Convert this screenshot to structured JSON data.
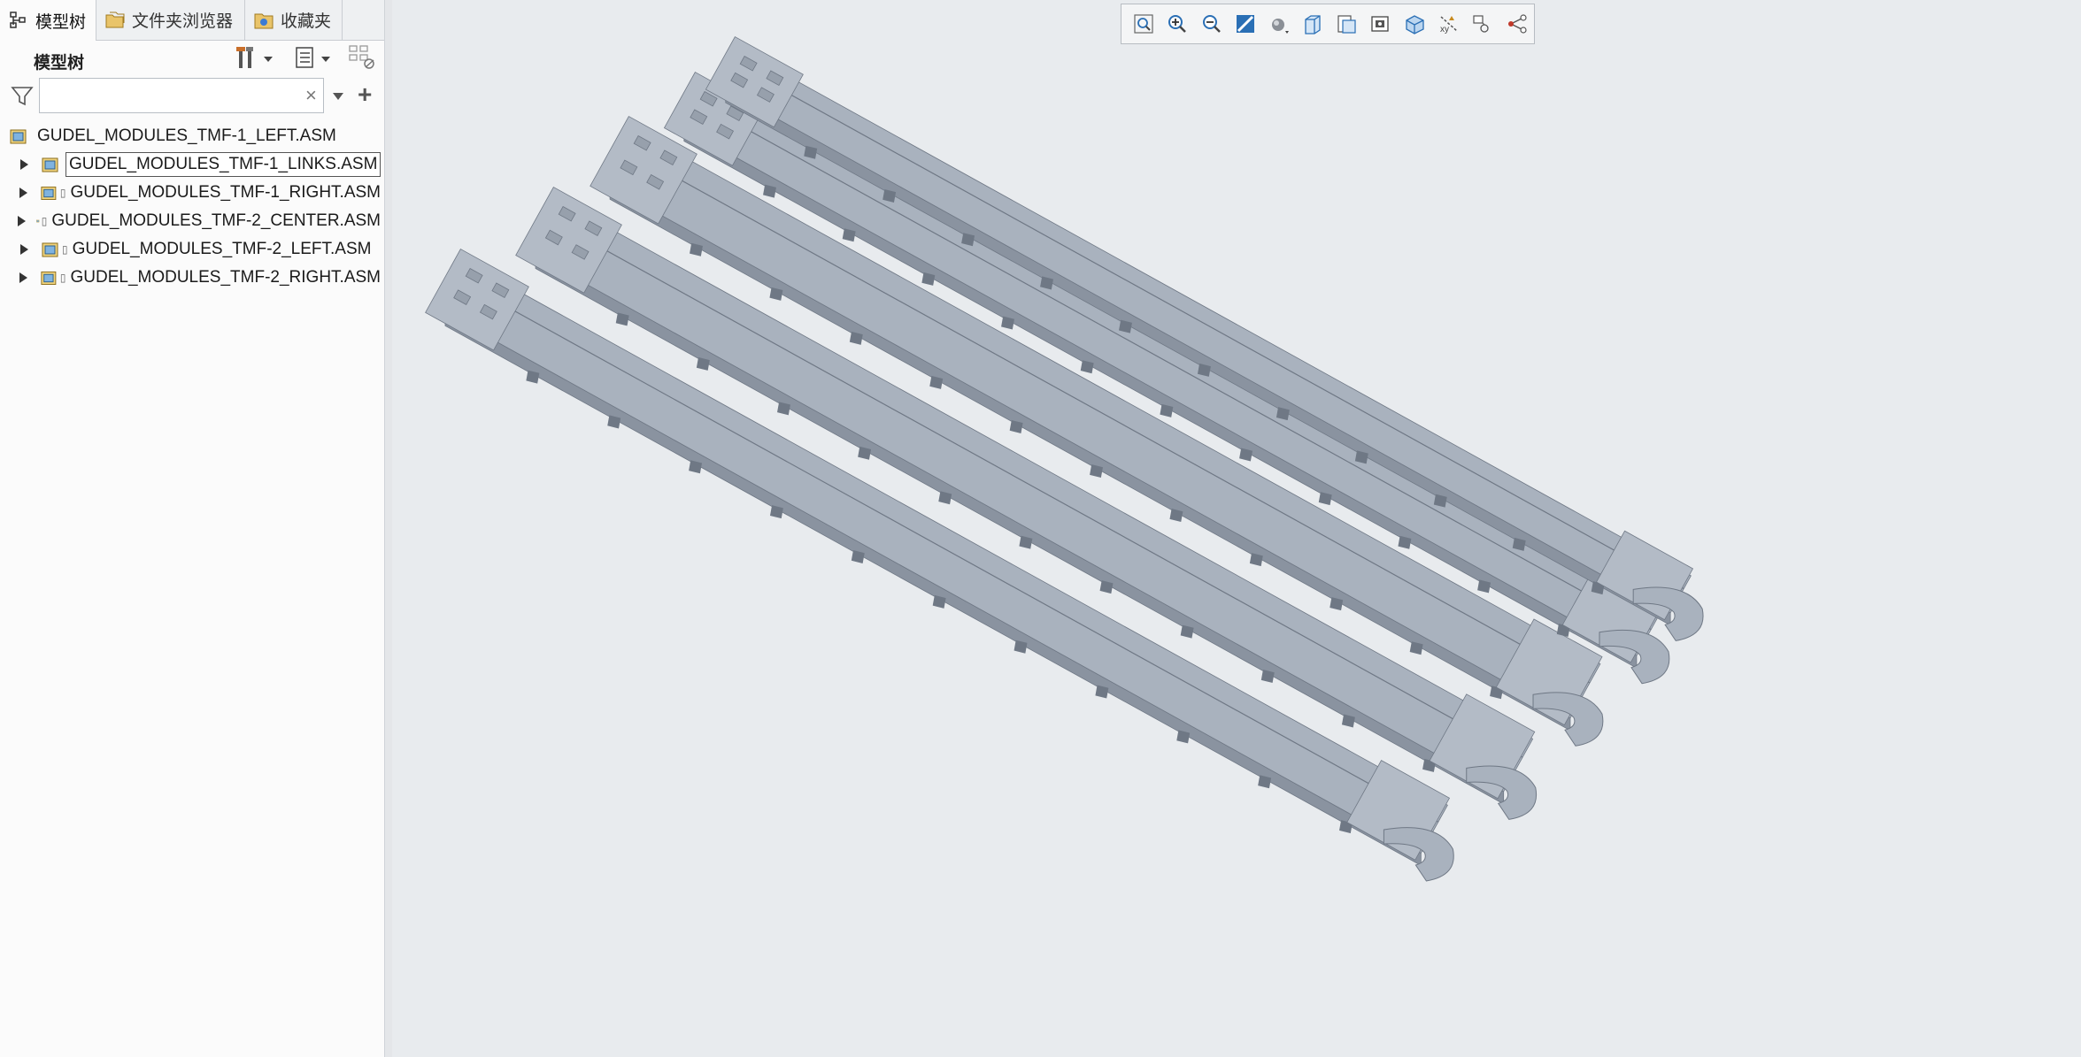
{
  "tabs": [
    {
      "label": "模型树",
      "icon": "model-tree-icon"
    },
    {
      "label": "文件夹浏览器",
      "icon": "folder-browser-icon"
    },
    {
      "label": "收藏夹",
      "icon": "favorites-icon"
    }
  ],
  "tree_header": {
    "title": "模型树",
    "settings_icon": "tools-icon",
    "show_icon": "list-view-icon",
    "columns_icon": "tree-columns-icon"
  },
  "filter": {
    "value": "",
    "placeholder": "",
    "clear_glyph": "×",
    "add_glyph": "+"
  },
  "tree": {
    "root": {
      "label": "GUDEL_MODULES_TMF-1_LEFT.ASM",
      "icon": "assembly-icon"
    },
    "children": [
      {
        "label": "GUDEL_MODULES_TMF-1_LINKS.ASM",
        "selected": true,
        "marker": ""
      },
      {
        "label": "GUDEL_MODULES_TMF-1_RIGHT.ASM",
        "selected": false,
        "marker": "▯"
      },
      {
        "label": "GUDEL_MODULES_TMF-2_CENTER.ASM",
        "selected": false,
        "marker": "▯"
      },
      {
        "label": "GUDEL_MODULES_TMF-2_LEFT.ASM",
        "selected": false,
        "marker": "▯"
      },
      {
        "label": "GUDEL_MODULES_TMF-2_RIGHT.ASM",
        "selected": false,
        "marker": "▯"
      }
    ]
  },
  "view_toolbar": [
    "zoom-fit-icon",
    "zoom-in-icon",
    "zoom-out-icon",
    "repaint-icon",
    "display-style-icon",
    "saved-views-icon",
    "view-manager-icon",
    "perspective-icon",
    "section-icon",
    "datum-display-icon",
    "annotation-display-icon",
    "spin-center-icon"
  ],
  "colors": {
    "viewport_bg": "#e8ebee",
    "model_top": "#a9b2be",
    "model_side": "#8a93a0",
    "model_dark": "#6f7885",
    "accent_blue": "#2a6fb5"
  },
  "model": {
    "name": "gantry-rails-assembly",
    "rail_count": 5
  }
}
